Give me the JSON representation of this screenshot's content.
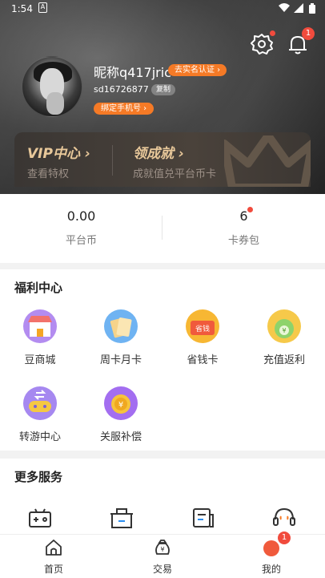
{
  "status_bar": {
    "time": "1:54"
  },
  "header": {
    "nickname": "昵称q417jric",
    "verify_label": "去实名认证 ›",
    "user_id": "sd16726877",
    "copy_label": "复制",
    "bind_phone_label": "绑定手机号 ›",
    "notification_count": "1"
  },
  "vip_card": {
    "vip_title": "VIP中心 ›",
    "vip_sub": "查看特权",
    "gift_title": "领成就 ›",
    "gift_sub": "成就值兑平台币卡"
  },
  "assets": [
    {
      "value": "0.00",
      "label": "平台币"
    },
    {
      "value": "6",
      "label": "卡券包"
    }
  ],
  "welfare": {
    "title": "福利中心",
    "items": [
      {
        "label": "豆商城",
        "icon": "shop-icon"
      },
      {
        "label": "周卡月卡",
        "icon": "card-icon"
      },
      {
        "label": "省钱卡",
        "icon": "save-money-icon"
      },
      {
        "label": "充值返利",
        "icon": "rebate-icon"
      },
      {
        "label": "转游中心",
        "icon": "game-transfer-icon"
      },
      {
        "label": "关服补偿",
        "icon": "compensation-icon"
      }
    ],
    "save_money_text": "省钱",
    "coin_symbol": "¥"
  },
  "services": {
    "title": "更多服务"
  },
  "tabbar": {
    "tabs": [
      {
        "label": "首页"
      },
      {
        "label": "交易"
      },
      {
        "label": "我的"
      }
    ],
    "mine_badge": "1",
    "trade_symbol": "¥"
  },
  "colors": {
    "accent": "#f57a26",
    "badge": "#f14b3d",
    "vip_gold": "#e8c89a"
  }
}
